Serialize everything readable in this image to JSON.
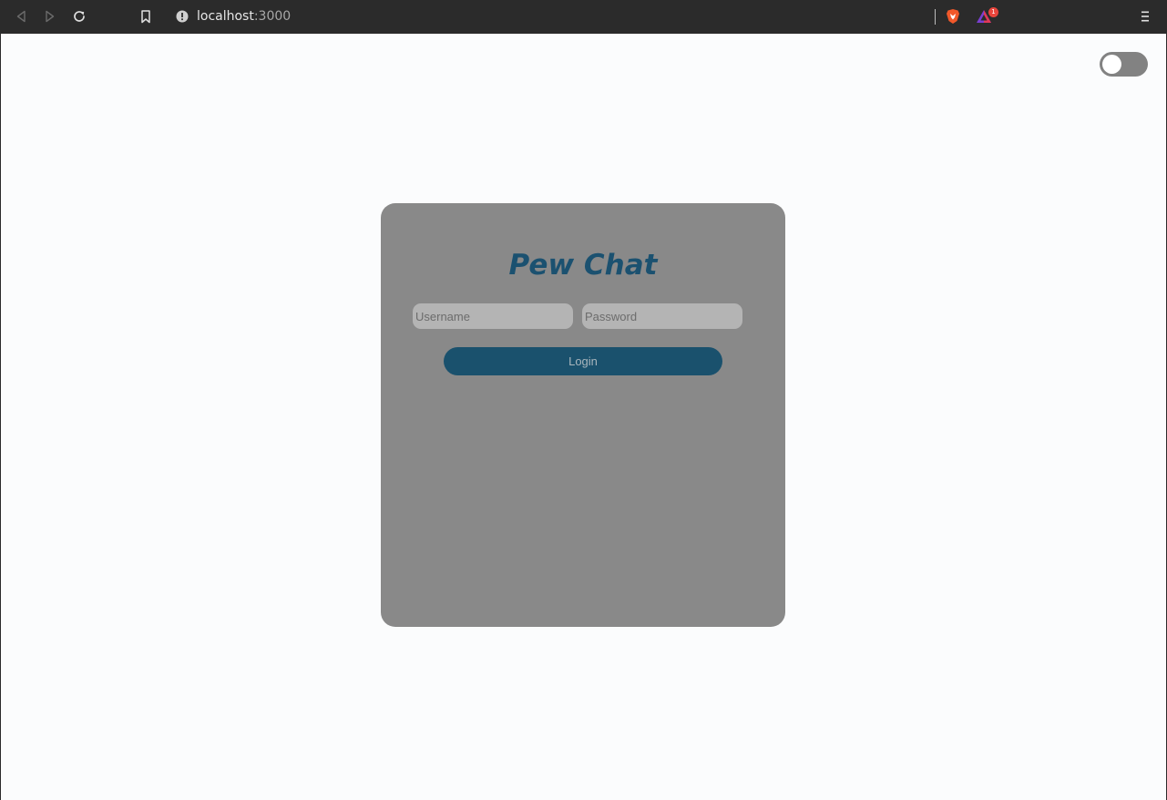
{
  "browser": {
    "url_host": "localhost",
    "url_port": ":3000",
    "notification_count": "1",
    "icons": [
      "back-icon",
      "forward-icon",
      "reload-icon",
      "bookmark-icon",
      "site-info-icon",
      "brave-shields-icon",
      "brave-rewards-icon",
      "menu-icon"
    ]
  },
  "page": {
    "theme_toggle": {
      "state": "off"
    },
    "login": {
      "title": "Pew Chat",
      "username_placeholder": "Username",
      "password_placeholder": "Password",
      "button_label": "Login"
    }
  },
  "colors": {
    "card_background": "#898989",
    "accent": "#1a516d",
    "page_background": "#fbfcfd"
  }
}
